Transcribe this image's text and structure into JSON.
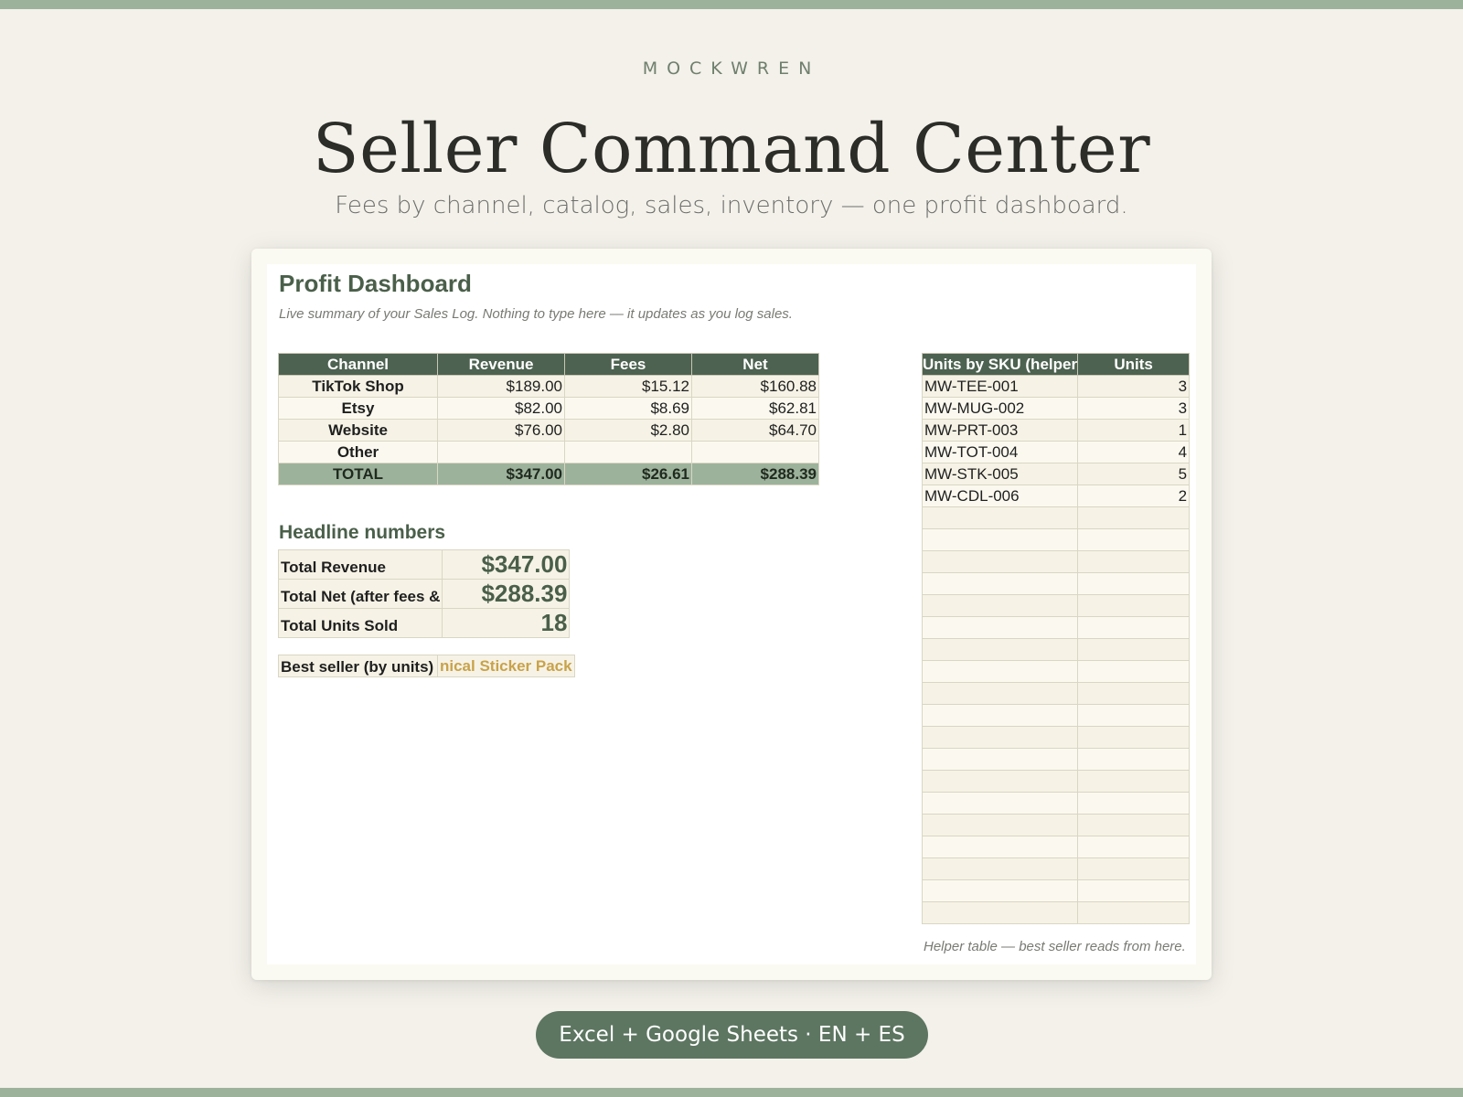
{
  "brand": "MOCKWREN",
  "hero": {
    "title": "Seller Command Center",
    "subtitle": "Fees by channel, catalog, sales, inventory — one profit dashboard."
  },
  "sheet": {
    "title": "Profit Dashboard",
    "description": "Live summary of your Sales Log. Nothing to type here — it updates as you log sales.",
    "channel_table": {
      "headers": [
        "Channel",
        "Revenue",
        "Fees",
        "Net"
      ],
      "rows": [
        {
          "channel": "TikTok Shop",
          "revenue": "$189.00",
          "fees": "$15.12",
          "net": "$160.88"
        },
        {
          "channel": "Etsy",
          "revenue": "$82.00",
          "fees": "$8.69",
          "net": "$62.81"
        },
        {
          "channel": "Website",
          "revenue": "$76.00",
          "fees": "$2.80",
          "net": "$64.70"
        },
        {
          "channel": "Other",
          "revenue": "",
          "fees": "",
          "net": ""
        }
      ],
      "total": {
        "channel": "TOTAL",
        "revenue": "$347.00",
        "fees": "$26.61",
        "net": "$288.39"
      }
    },
    "headline": {
      "title": "Headline numbers",
      "rows": [
        {
          "label": "Total Revenue",
          "value": "$347.00"
        },
        {
          "label": "Total Net (after fees &",
          "value": "$288.39"
        },
        {
          "label": "Total Units Sold",
          "value": "18"
        }
      ]
    },
    "best_seller": {
      "label": "Best seller (by units)",
      "value": "nical Sticker Pack"
    },
    "sku_table": {
      "headers": [
        "Units by SKU (helper",
        "Units"
      ],
      "rows": [
        {
          "sku": "MW-TEE-001",
          "units": "3"
        },
        {
          "sku": "MW-MUG-002",
          "units": "3"
        },
        {
          "sku": "MW-PRT-003",
          "units": "1"
        },
        {
          "sku": "MW-TOT-004",
          "units": "4"
        },
        {
          "sku": "MW-STK-005",
          "units": "5"
        },
        {
          "sku": "MW-CDL-006",
          "units": "2"
        }
      ]
    },
    "helper_note": "Helper table — best seller reads from here."
  },
  "badge": "Excel + Google Sheets · EN + ES"
}
